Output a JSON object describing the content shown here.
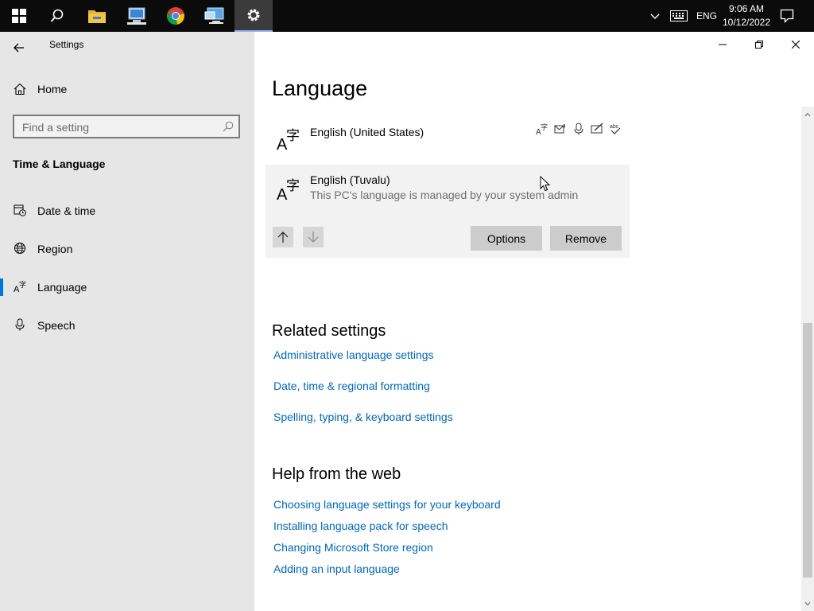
{
  "taskbar": {
    "apps": [
      {
        "icon": "windows-start-icon"
      },
      {
        "icon": "search-icon"
      },
      {
        "icon": "file-explorer-icon"
      },
      {
        "icon": "network-computer-icon"
      },
      {
        "icon": "chrome-icon"
      },
      {
        "icon": "remote-desktop-icon"
      },
      {
        "icon": "settings-gear-icon"
      }
    ],
    "tray": {
      "language": "ENG",
      "time": "9:06 AM",
      "date": "10/12/2022"
    }
  },
  "window": {
    "title": "Settings"
  },
  "sidebar": {
    "home_label": "Home",
    "search_placeholder": "Find a setting",
    "section_title": "Time & Language",
    "items": [
      {
        "label": "Date & time",
        "icon": "calendar-clock-icon"
      },
      {
        "label": "Region",
        "icon": "globe-icon"
      },
      {
        "label": "Language",
        "icon": "language-icon",
        "selected": true
      },
      {
        "label": "Speech",
        "icon": "microphone-icon"
      }
    ]
  },
  "main": {
    "title": "Language",
    "languages": [
      {
        "name": "English (United States)",
        "features": [
          "display-language-icon",
          "text-to-speech-icon",
          "speech-recognition-icon",
          "handwriting-icon",
          "spelling-icon"
        ]
      },
      {
        "name": "English (Tuvalu)",
        "note": "This PC's language is managed by your system admin",
        "options_label": "Options",
        "remove_label": "Remove"
      }
    ],
    "related_title": "Related settings",
    "related_links": [
      "Administrative language settings",
      "Date, time & regional formatting",
      "Spelling, typing, & keyboard settings"
    ],
    "help_title": "Help from the web",
    "help_links": [
      "Choosing language settings for your keyboard",
      "Installing language pack for speech",
      "Changing Microsoft Store region",
      "Adding an input language"
    ]
  },
  "colors": {
    "accent": "#0078d7",
    "link": "#0067b8",
    "sidebar_bg": "#e6e6e6",
    "taskbar_bg": "#0b0b0b"
  }
}
